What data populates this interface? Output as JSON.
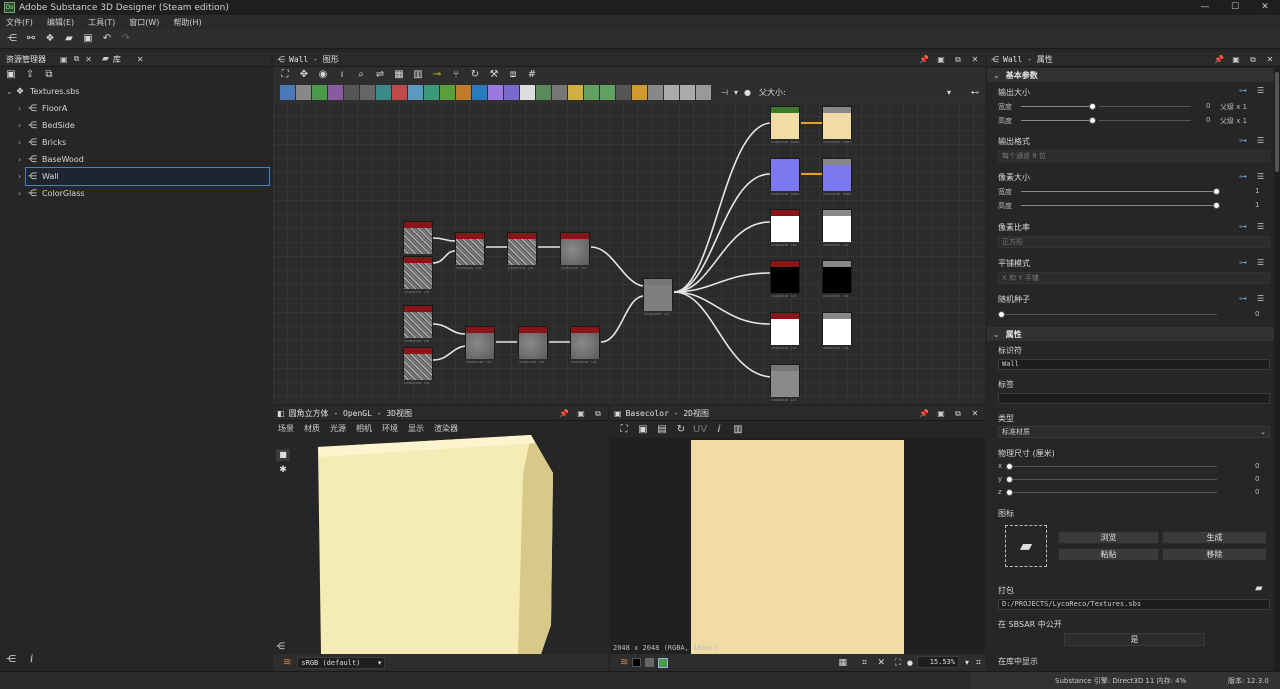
{
  "window": {
    "title": "Adobe Substance 3D Designer (Steam edition)",
    "app_icon": "Ds"
  },
  "menu": [
    "文件(F)",
    "编辑(E)",
    "工具(T)",
    "窗口(W)",
    "帮助(H)"
  ],
  "explorer": {
    "tab_label": "资源管理器",
    "library_label": "库",
    "root": "Textures.sbs",
    "items": [
      "FloorA",
      "BedSide",
      "Bricks",
      "BaseWood",
      "Wall",
      "ColorGlass"
    ],
    "selected": "Wall"
  },
  "graph": {
    "title": "Wall - 图形",
    "parent_size_label": "父大小:"
  },
  "view3d": {
    "title": "圆角立方体 - OpenGL - 3D视图",
    "menus": [
      "场景",
      "材质",
      "光源",
      "相机",
      "环境",
      "显示",
      "渲染器"
    ],
    "colorspace": "sRGB (default)"
  },
  "view2d": {
    "title": "Basecolor - 2D视图",
    "info": "2048 x 2048 (RGBA, 16bpc)",
    "zoom": "15.53%"
  },
  "properties": {
    "title": "Wall - 属性",
    "sec_basic": "基本参数",
    "output_size": {
      "label": "输出大小",
      "width_label": "宽度",
      "height_label": "高度",
      "width_val": "0",
      "height_val": "0",
      "width_rel": "父级 x 1",
      "height_rel": "父级 x 1"
    },
    "output_format": {
      "label": "输出格式",
      "value": "每个通道 8 位"
    },
    "pixel_size": {
      "label": "像素大小",
      "width_label": "宽度",
      "height_label": "高度",
      "width_val": "1",
      "height_val": "1"
    },
    "pixel_ratio": {
      "label": "像素比率",
      "value": "正方形"
    },
    "tiling": {
      "label": "平铺模式",
      "value": "X 和 Y 平铺"
    },
    "seed": {
      "label": "随机种子",
      "value": "0"
    },
    "sec_attr": "属性",
    "identifier": {
      "label": "标识符",
      "value": "Wall"
    },
    "tags_label": "标签",
    "type": {
      "label": "类型",
      "value": "标准材质"
    },
    "physical": {
      "label": "物理尺寸 (厘米)",
      "x_label": "x",
      "y_label": "y",
      "z_label": "z",
      "x": "0",
      "y": "0",
      "z": "0"
    },
    "icon_label": "图标",
    "buttons": {
      "browse": "浏览",
      "generate": "生成",
      "paste": "粘贴",
      "remove": "移除"
    },
    "package_label": "打包",
    "package_path": "D:/PROJECTS/LycoReco/Textures.sbs",
    "sbsar_label": "在 SBSAR 中公开",
    "sbsar_value": "是",
    "show_lib_label": "在库中显示"
  },
  "status": {
    "engine": "Substance 引擎: Direct3D 11 内存: 4%",
    "version": "版本: 12.3.0"
  },
  "colors": {
    "accent": "#4a7fd0",
    "cube": "#f5ebb5",
    "basecolor": "#f2dca6",
    "normal": "#7b78f0"
  }
}
